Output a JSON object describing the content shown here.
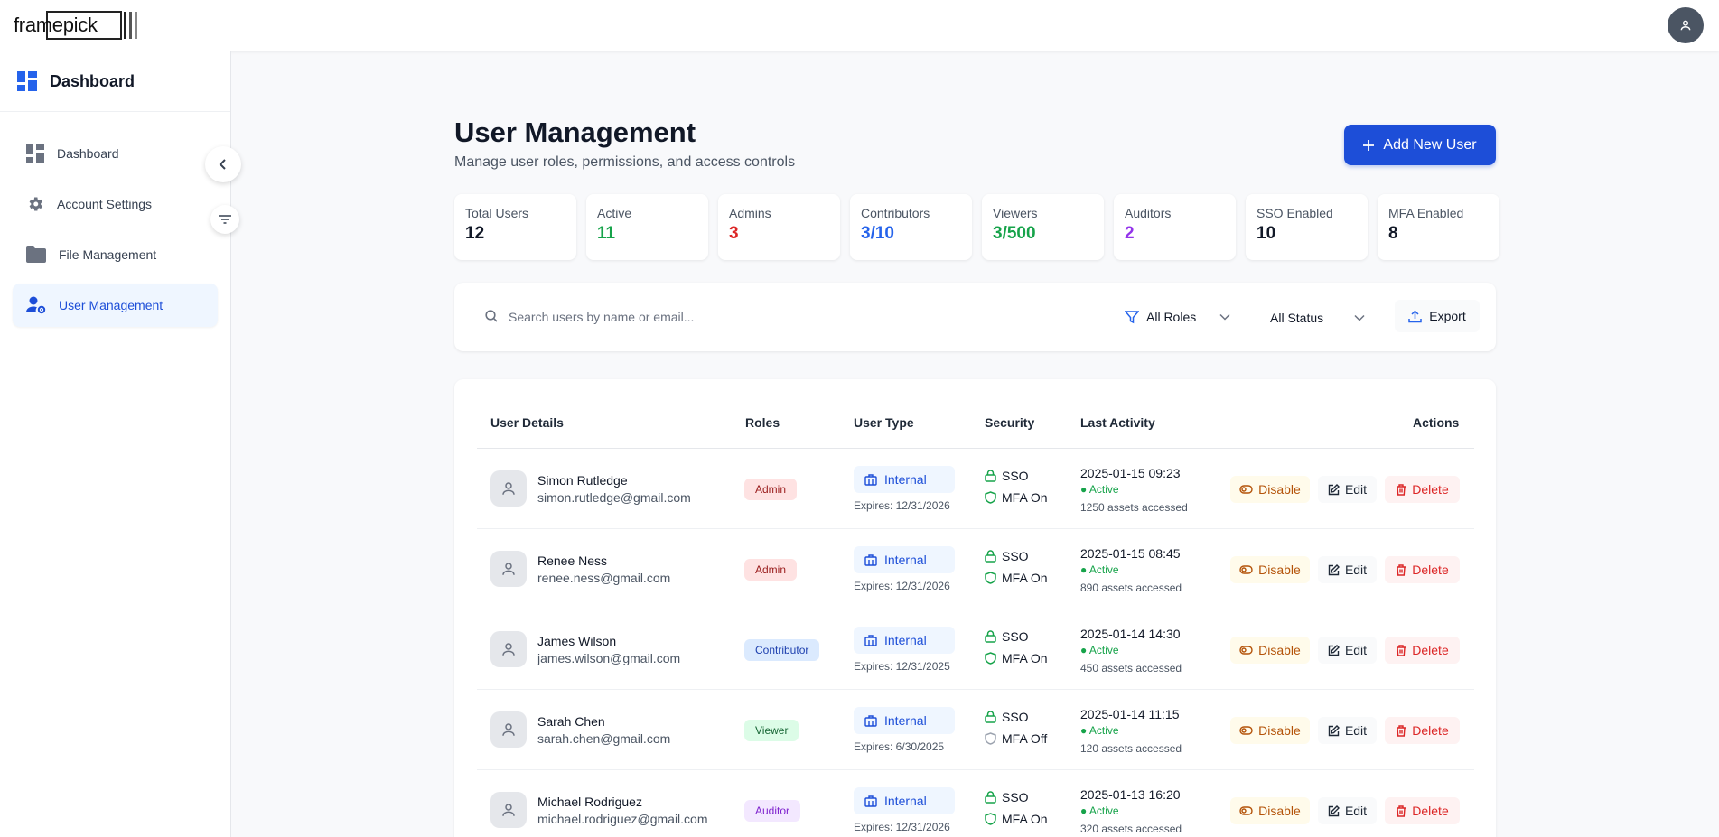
{
  "logo": {
    "text": "framepick"
  },
  "sidebar": {
    "title": "Dashboard",
    "items": [
      {
        "label": "Dashboard"
      },
      {
        "label": "Account Settings"
      },
      {
        "label": "File Management"
      },
      {
        "label": "User Management"
      }
    ]
  },
  "page": {
    "title": "User Management",
    "subtitle": "Manage user roles, permissions, and access controls",
    "add_button": "Add New User"
  },
  "stats": [
    {
      "label": "Total Users",
      "value": "12",
      "color": "#111827"
    },
    {
      "label": "Active",
      "value": "11",
      "color": "#16a34a"
    },
    {
      "label": "Admins",
      "value": "3",
      "color": "#dc2626"
    },
    {
      "label": "Contributors",
      "value": "3/10",
      "color": "#2563eb"
    },
    {
      "label": "Viewers",
      "value": "3/500",
      "color": "#16a34a"
    },
    {
      "label": "Auditors",
      "value": "2",
      "color": "#9333ea"
    },
    {
      "label": "SSO Enabled",
      "value": "10",
      "color": "#111827"
    },
    {
      "label": "MFA Enabled",
      "value": "8",
      "color": "#111827"
    }
  ],
  "filters": {
    "search_placeholder": "Search users by name or email...",
    "role": "All Roles",
    "status": "All Status",
    "export": "Export"
  },
  "table": {
    "headers": {
      "details": "User Details",
      "roles": "Roles",
      "type": "User Type",
      "security": "Security",
      "activity": "Last Activity",
      "actions": "Actions"
    },
    "actions": {
      "disable": "Disable",
      "edit": "Edit",
      "delete": "Delete"
    },
    "rows": [
      {
        "name": "Simon Rutledge",
        "email": "simon.rutledge@gmail.com",
        "role": "Admin",
        "type": "Internal",
        "expires": "Expires: 12/31/2026",
        "sso": "SSO",
        "mfa": "MFA On",
        "mfa_on": true,
        "time": "2025-01-15 09:23",
        "status": "● Active",
        "assets": "1250 assets accessed"
      },
      {
        "name": "Renee Ness",
        "email": "renee.ness@gmail.com",
        "role": "Admin",
        "type": "Internal",
        "expires": "Expires: 12/31/2026",
        "sso": "SSO",
        "mfa": "MFA On",
        "mfa_on": true,
        "time": "2025-01-15 08:45",
        "status": "● Active",
        "assets": "890 assets accessed"
      },
      {
        "name": "James Wilson",
        "email": "james.wilson@gmail.com",
        "role": "Contributor",
        "type": "Internal",
        "expires": "Expires: 12/31/2025",
        "sso": "SSO",
        "mfa": "MFA On",
        "mfa_on": true,
        "time": "2025-01-14 14:30",
        "status": "● Active",
        "assets": "450 assets accessed"
      },
      {
        "name": "Sarah Chen",
        "email": "sarah.chen@gmail.com",
        "role": "Viewer",
        "type": "Internal",
        "expires": "Expires: 6/30/2025",
        "sso": "SSO",
        "mfa": "MFA Off",
        "mfa_on": false,
        "time": "2025-01-14 11:15",
        "status": "● Active",
        "assets": "120 assets accessed"
      },
      {
        "name": "Michael Rodriguez",
        "email": "michael.rodriguez@gmail.com",
        "role": "Auditor",
        "type": "Internal",
        "expires": "Expires: 12/31/2026",
        "sso": "SSO",
        "mfa": "MFA On",
        "mfa_on": true,
        "time": "2025-01-13 16:20",
        "status": "● Active",
        "assets": "320 assets accessed"
      }
    ]
  }
}
